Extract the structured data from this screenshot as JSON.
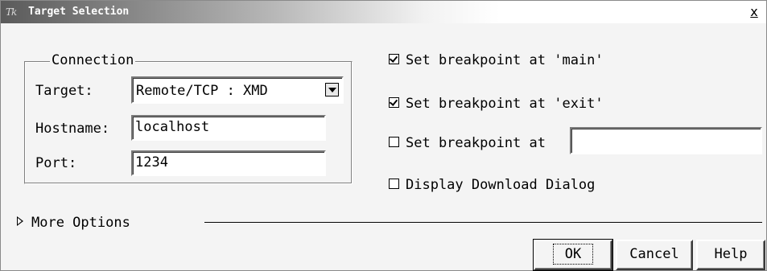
{
  "window": {
    "title": "Target Selection",
    "close_label": "x",
    "logo_text": "Tk"
  },
  "connection": {
    "legend": "Connection",
    "target_label": "Target:",
    "target_value": "Remote/TCP : XMD",
    "hostname_label": "Hostname:",
    "hostname_value": "localhost",
    "port_label": "Port:",
    "port_value": "1234"
  },
  "options": [
    {
      "label": "Set breakpoint at 'main'",
      "checked": true
    },
    {
      "label": "Set breakpoint at 'exit'",
      "checked": true
    },
    {
      "label": "Set breakpoint at",
      "checked": false,
      "input_value": ""
    },
    {
      "label": "Display Download Dialog",
      "checked": false
    }
  ],
  "more_options_label": "More Options",
  "buttons": {
    "ok": "OK",
    "cancel": "Cancel",
    "help": "Help"
  }
}
